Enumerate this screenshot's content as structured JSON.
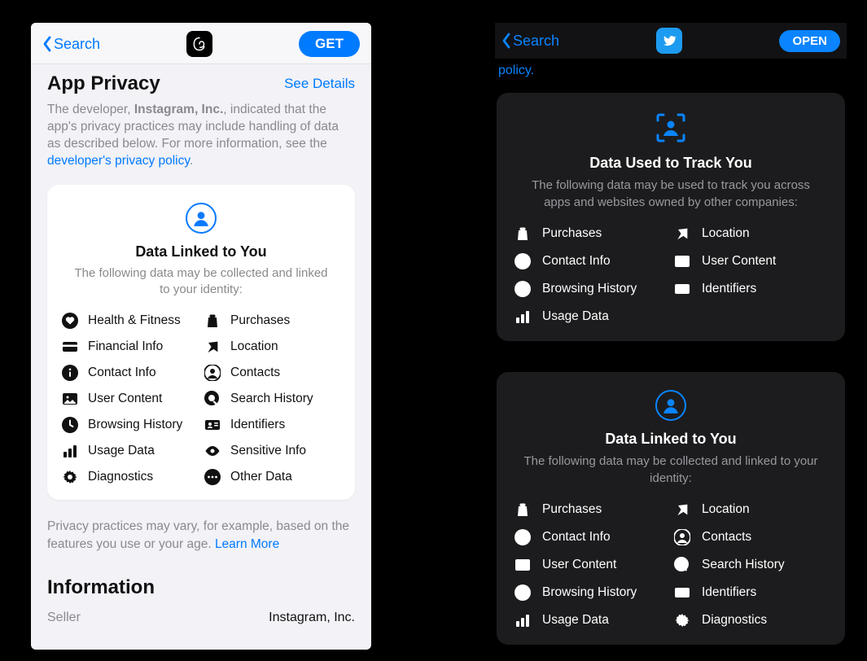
{
  "left": {
    "nav": {
      "back": "Search",
      "action": "GET"
    },
    "section": {
      "title": "App Privacy",
      "see_details": "See Details",
      "desc_pre": "The developer, ",
      "developer": "Instagram, Inc.",
      "desc_mid": ", indicated that the app's privacy practices may include handling of data as described below. For more information, see the ",
      "policy_link": "developer's privacy policy",
      "desc_end": "."
    },
    "card": {
      "title": "Data Linked to You",
      "sub": "The following data may be collected and linked to your identity:",
      "items_left": [
        {
          "icon": "heart",
          "label": "Health & Fitness"
        },
        {
          "icon": "card",
          "label": "Financial Info"
        },
        {
          "icon": "info",
          "label": "Contact Info"
        },
        {
          "icon": "image",
          "label": "User Content"
        },
        {
          "icon": "clock",
          "label": "Browsing History"
        },
        {
          "icon": "bars",
          "label": "Usage Data"
        },
        {
          "icon": "gear",
          "label": "Diagnostics"
        }
      ],
      "items_right": [
        {
          "icon": "bag",
          "label": "Purchases"
        },
        {
          "icon": "arrow",
          "label": "Location"
        },
        {
          "icon": "person",
          "label": "Contacts"
        },
        {
          "icon": "search",
          "label": "Search History"
        },
        {
          "icon": "idcard",
          "label": "Identifiers"
        },
        {
          "icon": "eye",
          "label": "Sensitive Info"
        },
        {
          "icon": "dots",
          "label": "Other Data"
        }
      ]
    },
    "footnote_pre": "Privacy practices may vary, for example, based on the features you use or your age. ",
    "footnote_link": "Learn More",
    "info": {
      "heading": "Information",
      "seller_label": "Seller",
      "seller_value": "Instagram, Inc."
    }
  },
  "right": {
    "nav": {
      "back": "Search",
      "action": "OPEN"
    },
    "policy_word": "policy",
    "card_track": {
      "title": "Data Used to Track You",
      "sub": "The following data may be used to track you across apps and websites owned by other companies:",
      "items_left": [
        {
          "icon": "bag",
          "label": "Purchases"
        },
        {
          "icon": "info",
          "label": "Contact Info"
        },
        {
          "icon": "clock",
          "label": "Browsing History"
        },
        {
          "icon": "bars",
          "label": "Usage Data"
        }
      ],
      "items_right": [
        {
          "icon": "arrow",
          "label": "Location"
        },
        {
          "icon": "image",
          "label": "User Content"
        },
        {
          "icon": "idcard",
          "label": "Identifiers"
        }
      ]
    },
    "card_linked": {
      "title": "Data Linked to You",
      "sub": "The following data may be collected and linked to your identity:",
      "items_left": [
        {
          "icon": "bag",
          "label": "Purchases"
        },
        {
          "icon": "info",
          "label": "Contact Info"
        },
        {
          "icon": "image",
          "label": "User Content"
        },
        {
          "icon": "clock",
          "label": "Browsing History"
        },
        {
          "icon": "bars",
          "label": "Usage Data"
        }
      ],
      "items_right": [
        {
          "icon": "arrow",
          "label": "Location"
        },
        {
          "icon": "person",
          "label": "Contacts"
        },
        {
          "icon": "search",
          "label": "Search History"
        },
        {
          "icon": "idcard",
          "label": "Identifiers"
        },
        {
          "icon": "gear",
          "label": "Diagnostics"
        }
      ]
    }
  }
}
